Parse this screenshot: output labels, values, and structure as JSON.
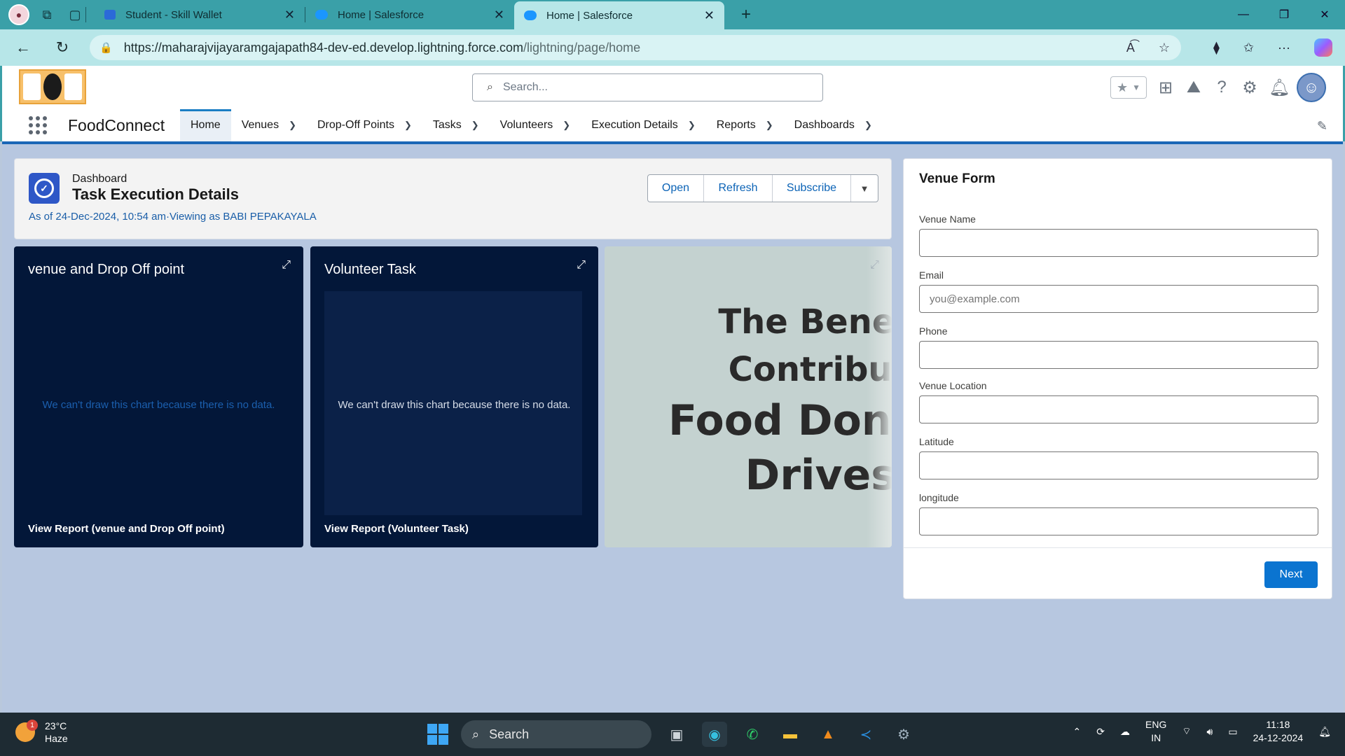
{
  "browser": {
    "tabs": [
      {
        "title": "Student - Skill Wallet",
        "favicon_color": "#2b6ad8"
      },
      {
        "title": "Home | Salesforce",
        "favicon_color": "#1b96ff"
      },
      {
        "title": "Home | Salesforce",
        "favicon_color": "#1b96ff",
        "active": true
      }
    ],
    "url_host": "https://maharajvijayaramgajapath84-dev-ed.develop.lightning.force.com",
    "url_path": "/lightning/page/home"
  },
  "salesforce": {
    "search_placeholder": "Search...",
    "app_name": "FoodConnect",
    "nav": [
      {
        "label": "Home",
        "active": true,
        "has_menu": false
      },
      {
        "label": "Venues",
        "has_menu": true
      },
      {
        "label": "Drop-Off Points",
        "has_menu": true
      },
      {
        "label": "Tasks",
        "has_menu": true
      },
      {
        "label": "Volunteers",
        "has_menu": true
      },
      {
        "label": "Execution Details",
        "has_menu": true
      },
      {
        "label": "Reports",
        "has_menu": true
      },
      {
        "label": "Dashboards",
        "has_menu": true
      }
    ]
  },
  "dashboard": {
    "eyebrow": "Dashboard",
    "title": "Task Execution Details",
    "as_of": "As of 24-Dec-2024, 10:54 am·Viewing as BABI PEPAKAYALA",
    "buttons": {
      "open": "Open",
      "refresh": "Refresh",
      "subscribe": "Subscribe"
    },
    "widgets": [
      {
        "title": "venue and Drop Off point",
        "nodata": "We can't draw this chart because there is no data.",
        "link": "View Report (venue and Drop Off point)"
      },
      {
        "title": "Volunteer Task",
        "nodata": "We can't draw this chart because there is no data.",
        "link": "View Report (Volunteer Task)"
      }
    ],
    "image_text": [
      "The Benefi",
      "Contributi",
      "Food Dona",
      "Drives"
    ]
  },
  "venue_form": {
    "title": "Venue Form",
    "fields": [
      {
        "label": "Venue Name",
        "placeholder": ""
      },
      {
        "label": "Email",
        "placeholder": "you@example.com"
      },
      {
        "label": "Phone",
        "placeholder": ""
      },
      {
        "label": "Venue Location",
        "placeholder": ""
      },
      {
        "label": "Latitude",
        "placeholder": ""
      },
      {
        "label": "longitude",
        "placeholder": ""
      }
    ],
    "next_label": "Next"
  },
  "taskbar": {
    "temp": "23°C",
    "condition": "Haze",
    "weather_badge": "1",
    "search_label": "Search",
    "lang_top": "ENG",
    "lang_bottom": "IN",
    "time": "11:18",
    "date": "24-12-2024"
  },
  "colors": {
    "accent": "#0b74d0",
    "widget_bg": "#031739",
    "tab_strip": "#3aa0a8"
  }
}
